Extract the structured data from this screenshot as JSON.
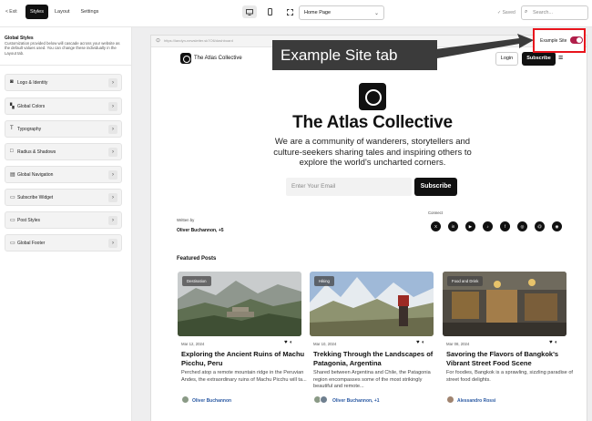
{
  "topbar": {
    "exit_label": "< Exit",
    "tabs": [
      "Styles",
      "Layout",
      "Settings"
    ],
    "device_icons": [
      "desktop-icon",
      "mobile-icon",
      "fullscreen-icon"
    ],
    "page_select": "Home Page",
    "saved_label": "✓ Saved",
    "search_placeholder": "Search..."
  },
  "sidebar": {
    "title": "Global Styles",
    "description": "Customization provided below will cascade across your website as the default values used. You can change these individually in the Layout tab.",
    "items": [
      {
        "label": "Logo & Identity",
        "icon": "camera-icon"
      },
      {
        "label": "Global Colors",
        "icon": "palette-icon"
      },
      {
        "label": "Typography",
        "icon": "type-icon"
      },
      {
        "label": "Radius & Shadows",
        "icon": "square-icon"
      },
      {
        "label": "Global Navigation",
        "icon": "navigation-icon"
      },
      {
        "label": "Subscribe Widget",
        "icon": "widget-icon"
      },
      {
        "label": "Post Styles",
        "icon": "post-icon"
      },
      {
        "label": "Global Footer",
        "icon": "footer-icon"
      }
    ]
  },
  "browser": {
    "url": "https://landyn-newsletter.sk7O6/dashboard"
  },
  "site": {
    "name": "The Atlas Collective",
    "login_label": "Login",
    "subscribe_label": "Subscribe",
    "hero_title": "The Atlas Collective",
    "hero_subtitle": "We are a community of wanderers, storytellers and culture-seekers sharing tales and inspiring others to explore the world's uncharted corners.",
    "email_placeholder": "Enter Your Email",
    "email_button": "Subscribe",
    "written_by_label": "Written by",
    "authors": "Oliver Buchannon, +5",
    "connect_label": "Connect",
    "social_icons": [
      "x-icon",
      "linkedin-icon",
      "youtube-icon",
      "tiktok-icon",
      "facebook-icon",
      "instagram-icon",
      "threads-icon",
      "discord-icon"
    ],
    "featured_label": "Featured Posts",
    "posts": [
      {
        "tag": "Destination",
        "date": "Mar 12, 2024",
        "title": "Exploring the Ancient Ruins of Machu Picchu, Peru",
        "excerpt": "Perched atop a remote mountain ridge in the Peruvian Andes, the extraordinary ruins of Machu Picchu will ta...",
        "author": "Oliver Buchannon"
      },
      {
        "tag": "Hiking",
        "date": "Mar 10, 2024",
        "title": "Trekking Through the Landscapes of Patagonia, Argentina",
        "excerpt": "Shared between Argentina and Chile, the Patagonia region encompasses some of the most strikingly beautiful and remote...",
        "author": "Oliver Buchannon, +1"
      },
      {
        "tag": "Food and Drink",
        "date": "Mar 08, 2024",
        "title": "Savoring the Flavors of Bangkok's Vibrant Street Food Scene",
        "excerpt": "For foodies, Bangkok is a sprawling, sizzling paradise of street food delights.",
        "author": "Alessandro Rossi"
      }
    ]
  },
  "annotation": {
    "callout_text": "Example Site tab",
    "toggle_label": "Example Site",
    "highlight_color": "#e8141c"
  }
}
